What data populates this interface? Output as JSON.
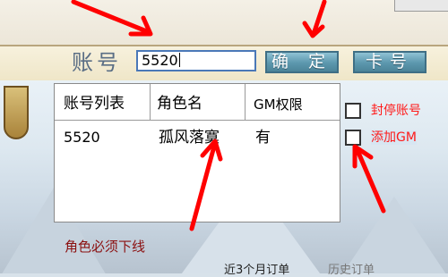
{
  "colors": {
    "arrow": "#ff0000",
    "label_red": "#ff1a1a",
    "note_red": "#8b1010",
    "button_blue": "#5c97ad",
    "input_border": "#4a78b8"
  },
  "account_bar": {
    "label": "账号",
    "input_value": "5520",
    "confirm_button": "确 定",
    "card_button": "卡号"
  },
  "account_list": {
    "headers": [
      "账号列表",
      "角色名",
      "GM权限"
    ],
    "rows": [
      [
        "5520",
        "孤风落寞",
        "有"
      ]
    ]
  },
  "options": {
    "ban_account": "封停账号",
    "add_gm": "添加GM"
  },
  "annotation": {
    "note": "角色必须下线",
    "arrow_icon": "red-arrow-icon"
  },
  "background": {
    "bottom_text_1": "近3个月订单",
    "bottom_text_2": "历史订单"
  }
}
